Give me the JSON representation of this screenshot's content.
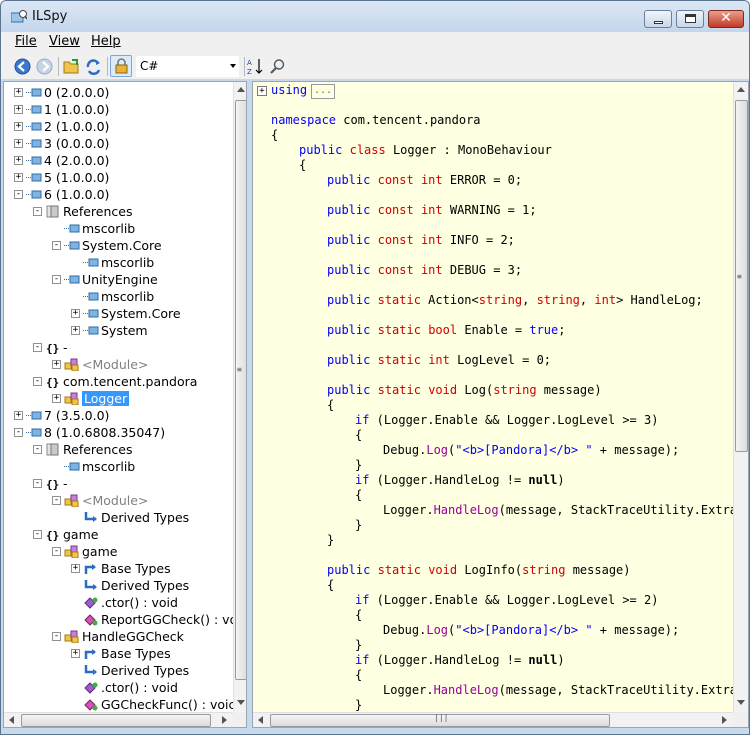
{
  "window": {
    "title": "ILSpy"
  },
  "menu": {
    "file": "File",
    "view": "View",
    "help": "Help"
  },
  "toolbar": {
    "language": "C#"
  },
  "tree": [
    {
      "label": "0 (2.0.0.0)"
    },
    {
      "label": "1 (1.0.0.0)"
    },
    {
      "label": "2 (1.0.0.0)"
    },
    {
      "label": "3 (0.0.0.0)"
    },
    {
      "label": "4 (2.0.0.0)"
    },
    {
      "label": "5 (1.0.0.0)"
    },
    {
      "label": "6 (1.0.0.0)"
    },
    {
      "label": "References"
    },
    {
      "label": "mscorlib"
    },
    {
      "label": "System.Core"
    },
    {
      "label": "mscorlib"
    },
    {
      "label": "UnityEngine"
    },
    {
      "label": "mscorlib"
    },
    {
      "label": "System.Core"
    },
    {
      "label": "System"
    },
    {
      "label": "-"
    },
    {
      "label": "<Module>"
    },
    {
      "label": "com.tencent.pandora"
    },
    {
      "label": "Logger"
    },
    {
      "label": "7 (3.5.0.0)"
    },
    {
      "label": "8 (1.0.6808.35047)"
    },
    {
      "label": "References"
    },
    {
      "label": "mscorlib"
    },
    {
      "label": "-"
    },
    {
      "label": "<Module>"
    },
    {
      "label": "Derived Types"
    },
    {
      "label": "game"
    },
    {
      "label": "game"
    },
    {
      "label": "Base Types"
    },
    {
      "label": "Derived Types"
    },
    {
      "label": ".ctor() : void"
    },
    {
      "label": "ReportGGCheck() : vo"
    },
    {
      "label": "HandleGGCheck"
    },
    {
      "label": "Base Types"
    },
    {
      "label": "Derived Types"
    },
    {
      "label": ".ctor() : void"
    },
    {
      "label": "GGCheckFunc() : voic"
    }
  ],
  "code": {
    "using_kw": "using",
    "collapsed": "...",
    "namespace_kw": "namespace",
    "namespace_name": " com.tencent.pandora",
    "open_brace": "{",
    "close_brace": "}",
    "public": "public",
    "class": "class",
    "const": "const",
    "static": "static",
    "int": "int",
    "bool": "bool",
    "void": "void",
    "string": "string",
    "true": "true",
    "if": "if",
    "null": "null",
    "class_decl": " Logger : MonoBehaviour",
    "error": " ERROR = 0;",
    "warning": " WARNING = 1;",
    "info": " INFO = 2;",
    "debug": " DEBUG = 3;",
    "action_start": " Action<",
    "comma": ", ",
    "action_end": "> HandleLog;",
    "enable": " Enable = ",
    "semicolon": ";",
    "loglevel": " LogLevel = 0;",
    "log_name": " Log(",
    "message_param": " message)",
    "if_cond_3": " (Logger.Enable && Logger.LogLevel >= 3)",
    "if_cond_2": " (Logger.Enable && Logger.LogLevel >= 2)",
    "debug_log_a": "Debug.",
    "log_method": "Log",
    "debug_log_b": "(",
    "pandora_str": "\"<b>[Pandora]</b> \"",
    "debug_log_c": " + message);",
    "handlelog_cond": " (Logger.HandleLog != ",
    "paren_close": ")",
    "handlelog_call_a": "Logger.",
    "handlelog_method": "HandleLog",
    "handlelog_call_b": "(message, StackTraceUtility.Extra",
    "loginfo_name": " LogInfo("
  }
}
